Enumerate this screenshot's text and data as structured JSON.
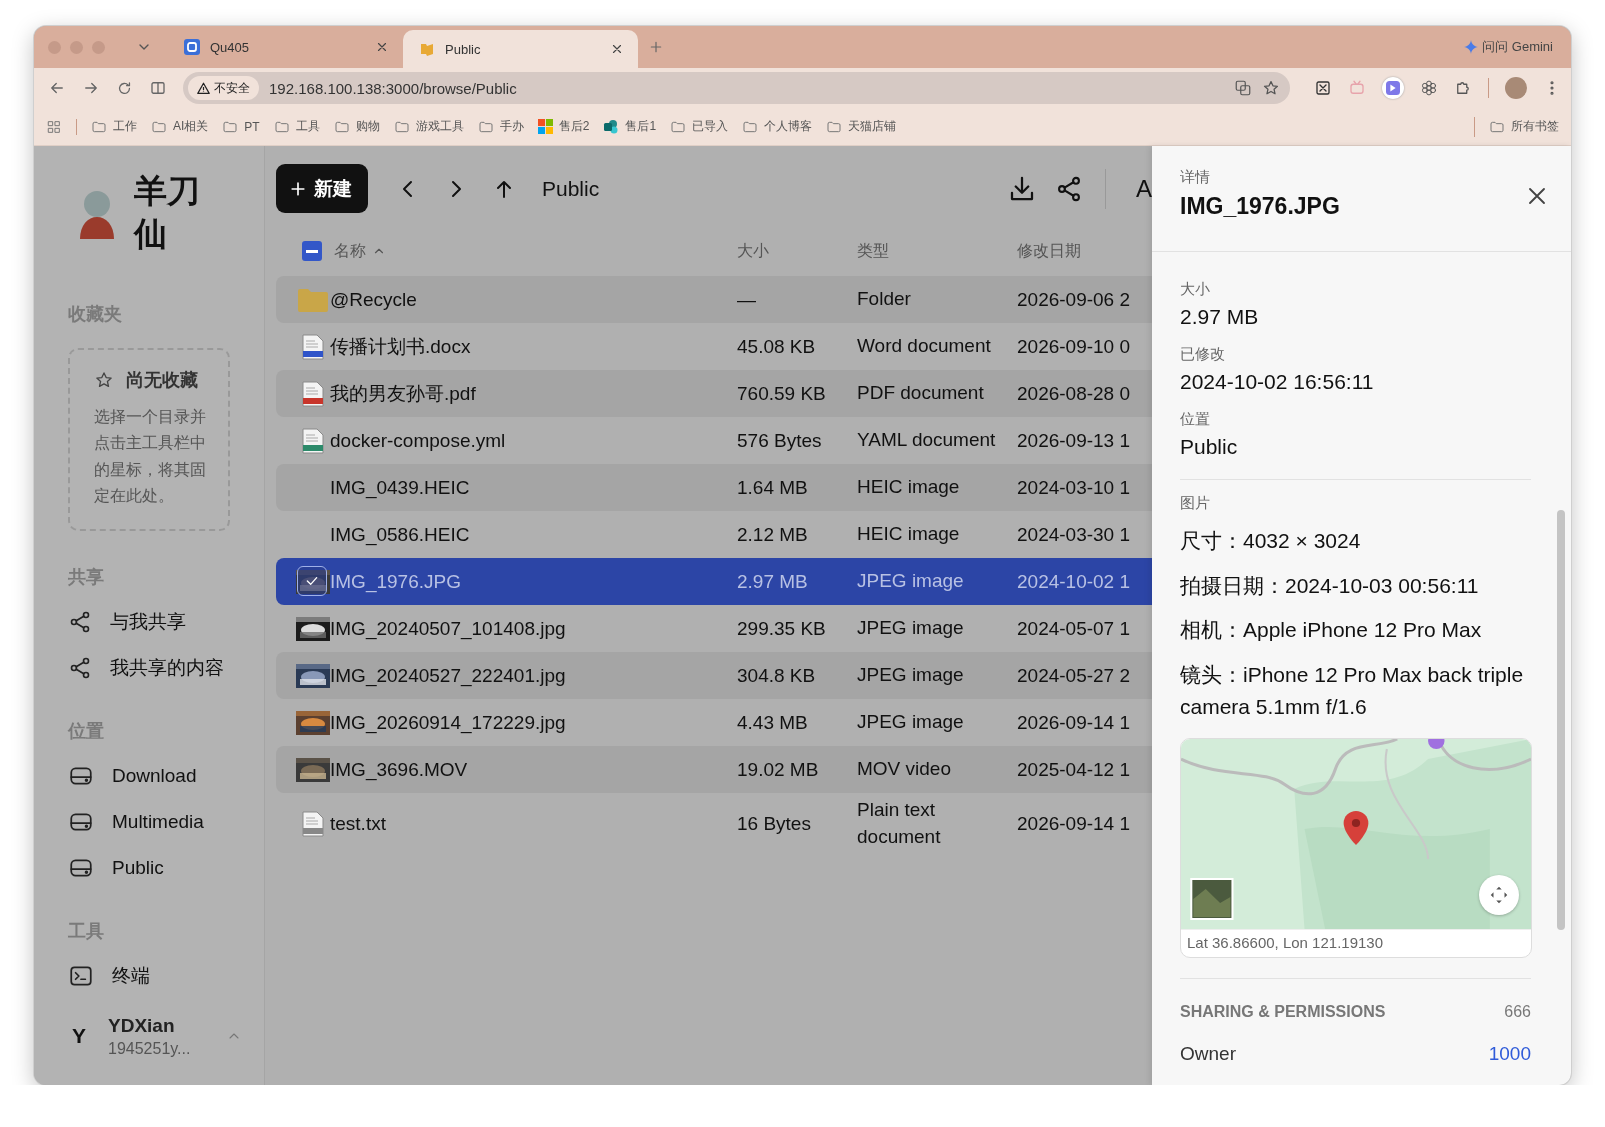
{
  "browser": {
    "tabs": [
      {
        "title": "Qu405",
        "selected": false,
        "kind": "app"
      },
      {
        "title": "Public",
        "selected": true,
        "kind": "flag"
      }
    ],
    "gemini": "问问 Gemini",
    "security": "不安全",
    "url": "192.168.100.138:3000/browse/Public",
    "bookmarks": [
      {
        "label": "工作",
        "kind": "folder"
      },
      {
        "label": "AI相关",
        "kind": "folder"
      },
      {
        "label": "PT",
        "kind": "folder"
      },
      {
        "label": "工具",
        "kind": "folder"
      },
      {
        "label": "购物",
        "kind": "folder"
      },
      {
        "label": "游戏工具",
        "kind": "folder"
      },
      {
        "label": "手办",
        "kind": "folder"
      },
      {
        "label": "售后2",
        "kind": "tiles"
      },
      {
        "label": "售后1",
        "kind": "share"
      },
      {
        "label": "已导入",
        "kind": "folder"
      },
      {
        "label": "个人博客",
        "kind": "folder"
      },
      {
        "label": "天猫店铺",
        "kind": "folder"
      }
    ],
    "all_bookmarks": "所有书签"
  },
  "sidebar": {
    "title": "羊刀仙",
    "favorites": {
      "heading": "收藏夹",
      "empty_title": "尚无收藏",
      "empty_text": "选择一个目录并点击主工具栏中的星标，将其固定在此处。"
    },
    "sections": [
      {
        "heading": "共享",
        "items": [
          {
            "label": "与我共享",
            "kind": "share"
          },
          {
            "label": "我共享的内容",
            "kind": "share"
          }
        ]
      },
      {
        "heading": "位置",
        "items": [
          {
            "label": "Download",
            "kind": "drive"
          },
          {
            "label": "Multimedia",
            "kind": "drive"
          },
          {
            "label": "Public",
            "kind": "drive"
          }
        ]
      },
      {
        "heading": "工具",
        "items": [
          {
            "label": "终端",
            "kind": "terminal"
          }
        ]
      }
    ],
    "user": {
      "initial": "Y",
      "name": "YDXian",
      "email": "1945251y..."
    }
  },
  "files": {
    "new_button": "新建",
    "path": "Public",
    "cut_button": "A",
    "select_all_partial": true,
    "sort_ascending": true,
    "columns": [
      "名称",
      "大小",
      "类型",
      "修改日期"
    ],
    "rows": [
      {
        "name": "@Recycle",
        "size": "—",
        "type": "Folder",
        "modified": "2026-09-06 2",
        "kind": "folder",
        "selected": false
      },
      {
        "name": "传播计划书.docx",
        "size": "45.08 KB",
        "type": "Word document",
        "modified": "2026-09-10 0",
        "kind": "word",
        "selected": false
      },
      {
        "name": "我的男友孙哥.pdf",
        "size": "760.59 KB",
        "type": "PDF document",
        "modified": "2026-08-28 0",
        "kind": "pdf",
        "selected": false
      },
      {
        "name": "docker-compose.yml",
        "size": "576 Bytes",
        "type": "YAML document",
        "modified": "2026-09-13 1",
        "kind": "yaml",
        "selected": false
      },
      {
        "name": "IMG_0439.HEIC",
        "size": "1.64 MB",
        "type": "HEIC image",
        "modified": "2024-03-10 1",
        "kind": "plain",
        "selected": false
      },
      {
        "name": "IMG_0586.HEIC",
        "size": "2.12 MB",
        "type": "HEIC image",
        "modified": "2024-03-30 1",
        "kind": "plain",
        "selected": false
      },
      {
        "name": "IMG_1976.JPG",
        "size": "2.97 MB",
        "type": "JPEG image",
        "modified": "2024-10-02 1",
        "selected": true
      },
      {
        "name": "IMG_20240507_101408.jpg",
        "size": "299.35 KB",
        "type": "JPEG image",
        "modified": "2024-05-07 1",
        "selected": false
      },
      {
        "name": "IMG_20240527_222401.jpg",
        "size": "304.8 KB",
        "type": "JPEG image",
        "modified": "2024-05-27 2",
        "selected": false
      },
      {
        "name": "IMG_20260914_172229.jpg",
        "size": "4.43 MB",
        "type": "JPEG image",
        "modified": "2026-09-14 1",
        "selected": false
      },
      {
        "name": "IMG_3696.MOV",
        "size": "19.02 MB",
        "type": "MOV video",
        "modified": "2025-04-12 1",
        "kind": "video",
        "selected": false
      },
      {
        "name": "test.txt",
        "size": "16 Bytes",
        "type": "Plain text document",
        "modified": "2026-09-14 1",
        "kind": "text",
        "selected": false
      }
    ]
  },
  "details": {
    "heading": "详情",
    "title": "IMG_1976.JPG",
    "fields": [
      {
        "label": "大小",
        "value": "2.97 MB"
      },
      {
        "label": "已修改",
        "value": "2024-10-02 16:56:11"
      },
      {
        "label": "位置",
        "value": "Public"
      }
    ],
    "image_heading": "图片",
    "image_props": [
      "尺寸：4032 × 3024",
      "拍摄日期：2024-10-03 00:56:11",
      "相机：Apple iPhone 12 Pro Max",
      "镜头：iPhone 12 Pro Max back triple camera 5.1mm f/1.6"
    ],
    "coords": "Lat 36.86600, Lon 121.19130",
    "sharing": {
      "heading": "SHARING & PERMISSIONS",
      "mode": "666",
      "owner_label": "Owner",
      "owner_value": "1000"
    }
  }
}
